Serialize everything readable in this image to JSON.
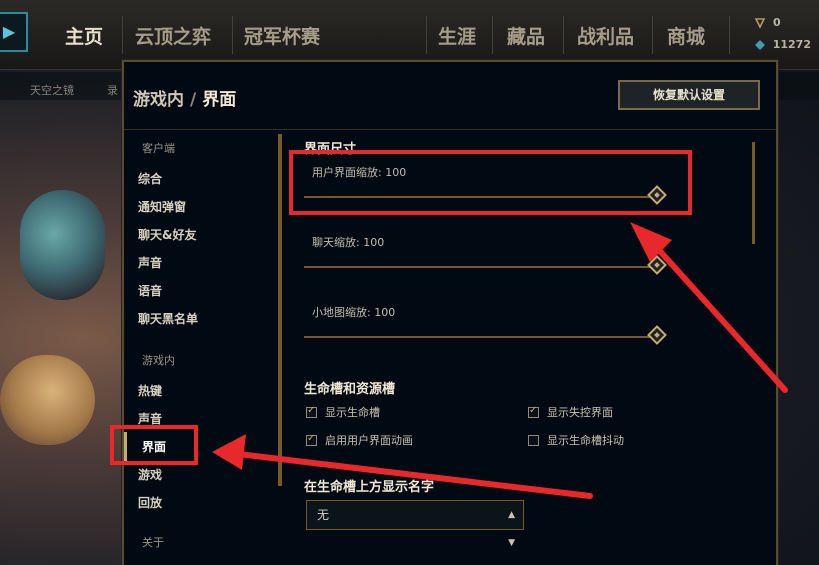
{
  "nav": {
    "home": "主页",
    "tft": "云顶之弈",
    "clash": "冠军杯赛",
    "profile": "生涯",
    "collection": "藏品",
    "loot": "战利品",
    "store": "商城",
    "currency_a": "0",
    "currency_b": "11272",
    "sub_left": "天空之镜",
    "sub_left2": "录"
  },
  "panel": {
    "breadcrumb_parent": "游戏内",
    "breadcrumb_sep": "/",
    "breadcrumb_current": "界面",
    "restore_label": "恢复默认设置"
  },
  "side_menu": {
    "group_client": "客户端",
    "general": "综合",
    "notifications": "通知弹窗",
    "chat_friends": "聊天&好友",
    "sound": "声音",
    "voice": "语音",
    "blocklist": "聊天黑名单",
    "group_ingame": "游戏内",
    "hotkeys": "热键",
    "sound2": "声音",
    "interface": "界面",
    "game": "游戏",
    "replay": "回放",
    "about": "关于"
  },
  "content": {
    "section_size": "界面尺寸",
    "ui_scale_label": "用户界面缩放: 100",
    "ui_scale_value": 100,
    "chat_scale_label": "聊天缩放: 100",
    "chat_scale_value": 100,
    "minimap_scale_label": "小地图缩放: 100",
    "minimap_scale_value": 100,
    "section_health": "生命槽和资源槽",
    "opt_show_health": "显示生命槽",
    "opt_show_health_checked": true,
    "opt_show_cc": "显示失控界面",
    "opt_show_cc_checked": true,
    "opt_ui_anim": "启用用户界面动画",
    "opt_ui_anim_checked": true,
    "opt_health_shake": "显示生命槽抖动",
    "opt_health_shake_checked": false,
    "section_names": "在生命槽上方显示名字",
    "names_select": "无"
  },
  "icons": {
    "play": "play-arrow-icon",
    "currency_a": "blue-essence-icon",
    "currency_b": "riot-points-icon",
    "select_chevron": "up-down-chevron-icon"
  },
  "colors": {
    "gold": "#c9aa71",
    "highlight": "#e8282a"
  }
}
